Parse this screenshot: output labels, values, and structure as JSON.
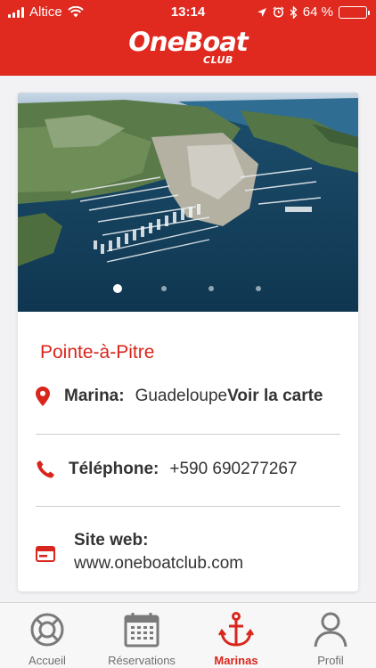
{
  "status_bar": {
    "carrier": "Altice",
    "time": "13:14",
    "battery_percent": "64 %",
    "battery_level": 0.64
  },
  "header": {
    "logo_main": "OneBoat",
    "logo_sub": "CLUB",
    "background_color": "#e0291f"
  },
  "gallery": {
    "page_count": 4,
    "active_index": 0
  },
  "marina": {
    "city": "Pointe-à-Pitre",
    "marina_label": "Marina:",
    "marina_value": "Guadeloupe",
    "map_link": "Voir la carte",
    "phone_label": "Téléphone:",
    "phone_value": "+590 690277267",
    "website_label": "Site web:",
    "website_value": "www.oneboatclub.com"
  },
  "tabbar": {
    "items": [
      {
        "label": "Accueil",
        "icon": "lifebuoy-icon"
      },
      {
        "label": "Réservations",
        "icon": "calendar-icon"
      },
      {
        "label": "Marinas",
        "icon": "anchor-icon",
        "active": true
      },
      {
        "label": "Profil",
        "icon": "person-icon"
      }
    ]
  },
  "colors": {
    "accent": "#d9261c",
    "inactive_tab": "#6e6e6e"
  }
}
